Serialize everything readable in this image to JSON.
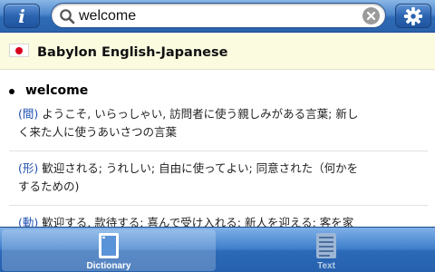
{
  "header": {
    "info_icon": "info-icon",
    "search": {
      "value": "welcome",
      "icons": [
        "search-icon",
        "clear-icon"
      ]
    },
    "settings_icon": "gear-icon"
  },
  "dictionary": {
    "name": "Babylon English-Japanese",
    "flag_icon": "japan-flag-icon"
  },
  "entry": {
    "headword": "welcome",
    "senses": [
      {
        "pos": "(間)",
        "text_line1": "ようこそ, いらっしゃい, 訪問者に使う親しみがある言葉; 新し",
        "text_line2": "く来た人に使うあいさつの言葉"
      },
      {
        "pos": "(形)",
        "text_line1": "歓迎される; うれしい; 自由に使ってよい; 同意された（何かを",
        "text_line2": "するための)"
      },
      {
        "pos": "(動)",
        "text_line1": "歓迎する, 款待する; 喜んで受け入れる; 新人を迎える; 客を家"
      }
    ]
  },
  "tabs": [
    {
      "label": "Dictionary",
      "icon": "dictionary-tab-icon",
      "selected": true
    },
    {
      "label": "Text",
      "icon": "text-tab-icon",
      "selected": false
    }
  ],
  "colors": {
    "toolbar_blue": "#2f6bb6",
    "header_bg": "#fbfbe0",
    "pos_blue": "#1f4fb0",
    "flag_red": "#d8001e"
  }
}
